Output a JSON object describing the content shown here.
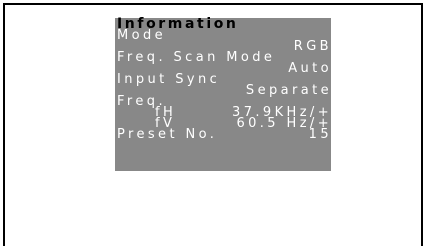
{
  "osd": {
    "title": "Information",
    "mode_label": "Mode",
    "mode_value": "RGB",
    "freq_scan_label": "Freq. Scan Mode",
    "freq_scan_value": "Auto",
    "input_sync_label": "Input Sync",
    "input_sync_value": "Separate",
    "freq_label": "Freq.",
    "fh_label": "fH",
    "fh_value": "37.9KHz/+",
    "fv_label": "fV",
    "fv_value": "60.5 Hz/+",
    "preset_label": "Preset No.",
    "preset_value": "15"
  },
  "colors": {
    "panel_background": "#888888",
    "text": "#ffffff",
    "title_text": "#000000"
  }
}
